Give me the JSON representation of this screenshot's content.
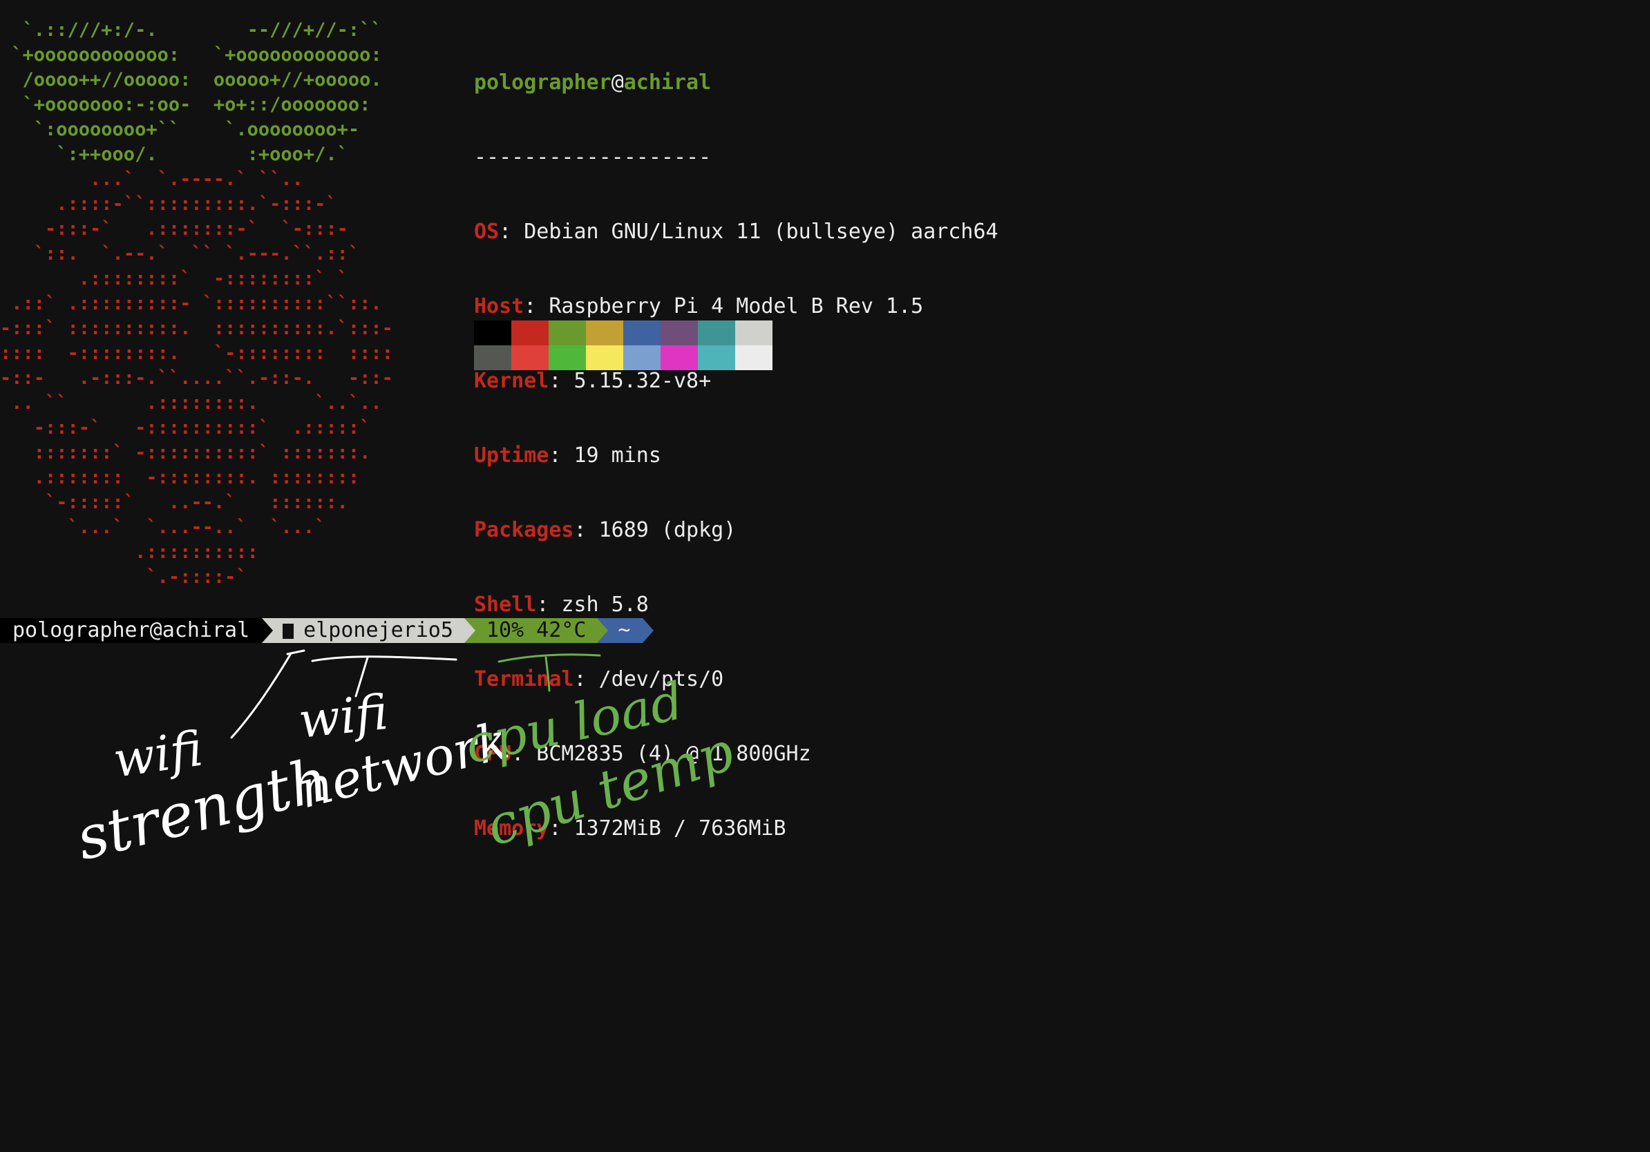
{
  "ascii_logo": {
    "green_lines": [
      "  `.::///+:/-.        --///+//-:``",
      " `+oooooooooooo:   `+oooooooooooo:",
      "  /oooo++//ooooo:  ooooo+//+ooooo.",
      "  `+ooooooo:-:oo-  +o+::/ooooooo:",
      "   `:oooooooo+``    `.oooooooo+-",
      "     `:++ooo/.        :+ooo+/.`"
    ],
    "red_lines": [
      "        ...`  `.----.` ``..",
      "     .::::-``:::::::::.`-:::-`",
      "    -:::-`   .:::::::-`  `-:::-",
      "   `::.  `.--.`  `` `.---.``.::`",
      "       .::::::::`  -::::::::` `",
      " .::` .:::::::::- `::::::::::``::.",
      "-:::` ::::::::::.  ::::::::::.`:::-",
      "::::  -::::::::.   `-::::::::  ::::",
      "-::-   .-:::-.``....``.-::-.   -::-",
      " .. ``       .::::::::.     `..`..",
      "   -:::-`   -::::::::::`  .:::::`",
      "   :::::::` -::::::::::` :::::::.",
      "   .:::::::  -::::::::. ::::::::",
      "    `-:::::`   ..--.`   ::::::.",
      "      `...`  `...--..`  `...`",
      "            .::::::::::",
      "             `.-::::-`"
    ]
  },
  "info": {
    "user": "polographer",
    "at": "@",
    "host": "achiral",
    "separator": "-------------------",
    "rows": [
      {
        "key": "OS",
        "value": ": Debian GNU/Linux 11 (bullseye) aarch64"
      },
      {
        "key": "Host",
        "value": ": Raspberry Pi 4 Model B Rev 1.5"
      },
      {
        "key": "Kernel",
        "value": ": 5.15.32-v8+"
      },
      {
        "key": "Uptime",
        "value": ": 19 mins"
      },
      {
        "key": "Packages",
        "value": ": 1689 (dpkg)"
      },
      {
        "key": "Shell",
        "value": ": zsh 5.8"
      },
      {
        "key": "Terminal",
        "value": ": /dev/pts/0"
      },
      {
        "key": "CPU",
        "value": ": BCM2835 (4) @ 1.800GHz"
      },
      {
        "key": "Memory",
        "value": ": 1372MiB / 7636MiB"
      }
    ]
  },
  "palette": {
    "normal": [
      "#000000",
      "#c4281e",
      "#6a9a2e",
      "#c2a033",
      "#3f62a0",
      "#6f4f7a",
      "#3f9494",
      "#d0d0cc"
    ],
    "bright": [
      "#555753",
      "#e0403a",
      "#4fb83a",
      "#f6e85c",
      "#7b9fce",
      "#df35c2",
      "#4eb4b9",
      "#ececec"
    ]
  },
  "prompt": {
    "user_host": "polographer@achiral",
    "wifi_network": "elponejerio5",
    "cpu_status": "10% 42°C",
    "directory": "~"
  },
  "annotations": {
    "wifi_strength_line1": "wifi",
    "wifi_strength_line2": "strength",
    "wifi_network_line1": "wifi",
    "wifi_network_line2": "network",
    "cpu_load": "cpu load",
    "cpu_temp": "cpu temp",
    "white": "#ffffff",
    "green": "#6ab04c"
  }
}
